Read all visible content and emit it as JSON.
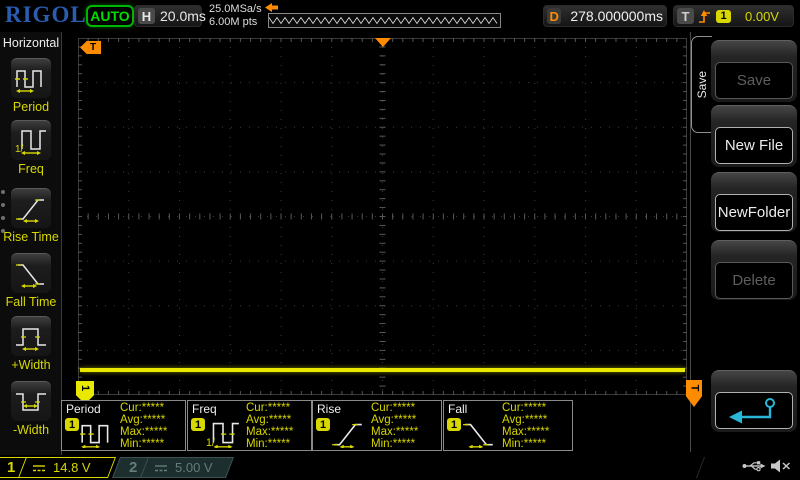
{
  "top_bar": {
    "brand": "RIGOL",
    "run_status": "AUTO",
    "horizontal": {
      "label": "H",
      "timebase": "20.0ms"
    },
    "acquisition": {
      "sample_rate": "25.0MSa/s",
      "memory_depth": "6.00M pts"
    },
    "delay": {
      "label": "D",
      "value": "278.000000ms"
    },
    "trigger": {
      "label": "T",
      "source_channel": "1",
      "level": "0.00V"
    }
  },
  "left_menu": {
    "title": "Horizontal",
    "items": [
      {
        "label": "Period",
        "icon": "period-icon"
      },
      {
        "label": "Freq",
        "icon": "freq-icon"
      },
      {
        "label": "Rise Time",
        "icon": "rise-time-icon"
      },
      {
        "label": "Fall Time",
        "icon": "fall-time-icon"
      },
      {
        "label": "+Width",
        "icon": "pwidth-icon"
      },
      {
        "label": "-Width",
        "icon": "nwidth-icon"
      }
    ]
  },
  "graticule": {
    "trigger_position_marker": "T",
    "trigger_level_marker": "T",
    "channel_marker": "1"
  },
  "right_menu": {
    "tab_label": "Save",
    "buttons": [
      {
        "label": "Save",
        "enabled": false
      },
      {
        "label": "New File",
        "enabled": true
      },
      {
        "label": "NewFolder",
        "enabled": true
      },
      {
        "label": "Delete",
        "enabled": false
      },
      {
        "label": "",
        "enabled": true,
        "icon": "return-arrow-icon"
      }
    ]
  },
  "measurements": [
    {
      "name": "Period",
      "channel": "1",
      "icon": "period-icon",
      "stats": [
        {
          "label": "Cur:",
          "value": "*****"
        },
        {
          "label": "Avg:",
          "value": "*****"
        },
        {
          "label": "Max:",
          "value": "*****"
        },
        {
          "label": "Min:",
          "value": "*****"
        }
      ]
    },
    {
      "name": "Freq",
      "channel": "1",
      "icon": "freq-icon",
      "stats": [
        {
          "label": "Cur:",
          "value": "*****"
        },
        {
          "label": "Avg:",
          "value": "*****"
        },
        {
          "label": "Max:",
          "value": "*****"
        },
        {
          "label": "Min:",
          "value": "*****"
        }
      ]
    },
    {
      "name": "Rise",
      "channel": "1",
      "icon": "rise-time-icon",
      "stats": [
        {
          "label": "Cur:",
          "value": "*****"
        },
        {
          "label": "Avg:",
          "value": "*****"
        },
        {
          "label": "Max:",
          "value": "*****"
        },
        {
          "label": "Min:",
          "value": "*****"
        }
      ]
    },
    {
      "name": "Fall",
      "channel": "1",
      "icon": "fall-time-icon",
      "stats": [
        {
          "label": "Cur:",
          "value": "*****"
        },
        {
          "label": "Avg:",
          "value": "*****"
        },
        {
          "label": "Max:",
          "value": "*****"
        },
        {
          "label": "Min:",
          "value": "*****"
        }
      ]
    }
  ],
  "bottom_bar": {
    "channels": [
      {
        "number": "1",
        "coupling": "dc-coupling-icon",
        "scale": "14.8 V",
        "active": true
      },
      {
        "number": "2",
        "coupling": "dc-coupling-icon",
        "scale": "5.00 V",
        "active": false
      }
    ],
    "status_icons": [
      "usb-icon",
      "speaker-muted-icon"
    ]
  },
  "colors": {
    "accent_yellow": "#d8d800",
    "accent_orange": "#ff8c00",
    "brand_blue": "#2a5db0",
    "status_green": "#00dd00",
    "return_cyan": "#29b6d8",
    "background": "#000000"
  }
}
